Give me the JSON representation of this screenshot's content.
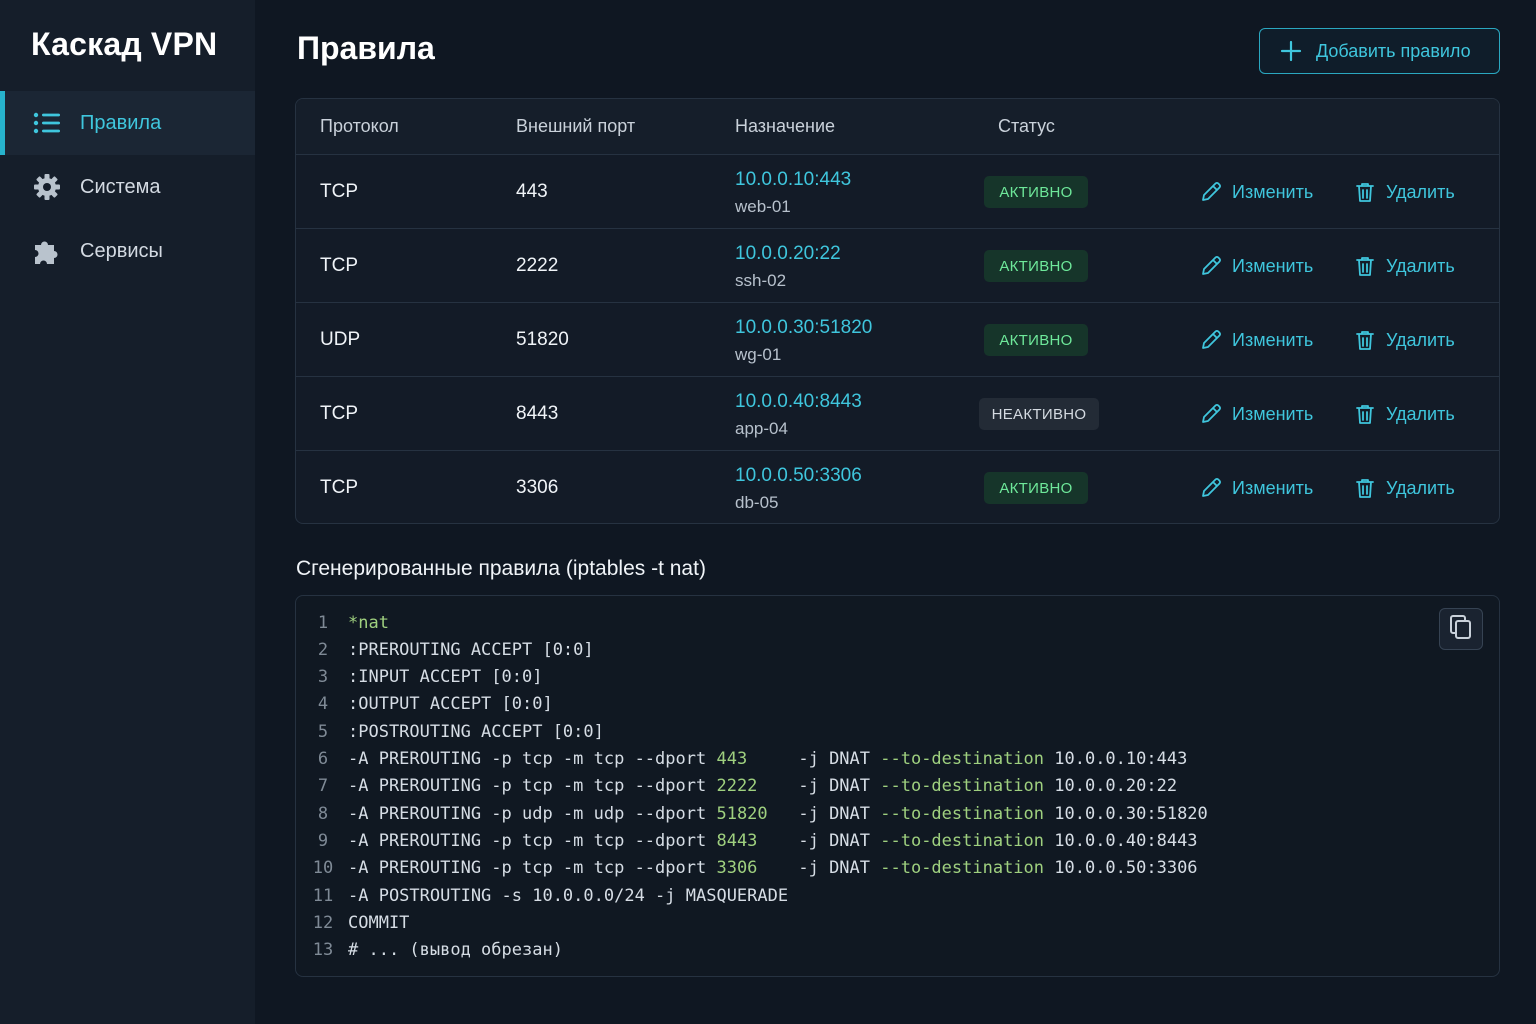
{
  "app": {
    "brand": "Каскад VPN"
  },
  "sidebar": {
    "items": [
      {
        "label": "Правила",
        "icon": "list-icon",
        "active": true
      },
      {
        "label": "Система",
        "icon": "gear-icon",
        "active": false
      },
      {
        "label": "Сервисы",
        "icon": "puzzle-icon",
        "active": false
      }
    ]
  },
  "header": {
    "title": "Правила",
    "add_label": "Добавить правило"
  },
  "table": {
    "columns": [
      "Протокол",
      "Внешний порт",
      "Назначение",
      "Статус"
    ],
    "edit_label": "Изменить",
    "delete_label": "Удалить",
    "rows": [
      {
        "protocol": "TCP",
        "port": "443",
        "dest_ip": "10.0.0.10:443",
        "dest_name": "web-01",
        "status": "АКТИВНО",
        "active": true
      },
      {
        "protocol": "TCP",
        "port": "2222",
        "dest_ip": "10.0.0.20:22",
        "dest_name": "ssh-02",
        "status": "АКТИВНО",
        "active": true
      },
      {
        "protocol": "UDP",
        "port": "51820",
        "dest_ip": "10.0.0.30:51820",
        "dest_name": "wg-01",
        "status": "АКТИВНО",
        "active": true
      },
      {
        "protocol": "TCP",
        "port": "8443",
        "dest_ip": "10.0.0.40:8443",
        "dest_name": "app-04",
        "status": "НЕАКТИВНО",
        "active": false
      },
      {
        "protocol": "TCP",
        "port": "3306",
        "dest_ip": "10.0.0.50:3306",
        "dest_name": "db-05",
        "status": "АКТИВНО",
        "active": true
      }
    ]
  },
  "generated": {
    "title": "Сгенерированные правила (iptables -t nat)",
    "lines": [
      {
        "n": "1",
        "parts": [
          {
            "t": "*nat",
            "g": true
          }
        ]
      },
      {
        "n": "2",
        "parts": [
          {
            "t": ":PREROUTING ACCEPT [0:0]"
          }
        ]
      },
      {
        "n": "3",
        "parts": [
          {
            "t": ":INPUT ACCEPT [0:0]"
          }
        ]
      },
      {
        "n": "4",
        "parts": [
          {
            "t": ":OUTPUT ACCEPT [0:0]"
          }
        ]
      },
      {
        "n": "5",
        "parts": [
          {
            "t": ":POSTROUTING ACCEPT [0:0]"
          }
        ]
      },
      {
        "n": "6",
        "parts": [
          {
            "t": "-A PREROUTING -p tcp -m tcp --dport "
          },
          {
            "t": "443  ",
            "g": true
          },
          {
            "t": "   -j DNAT "
          },
          {
            "t": "--to-destination",
            "g": true
          },
          {
            "t": " 10.0.0.10:443"
          }
        ]
      },
      {
        "n": "7",
        "parts": [
          {
            "t": "-A PREROUTING -p tcp -m tcp --dport "
          },
          {
            "t": "2222 ",
            "g": true
          },
          {
            "t": "   -j DNAT "
          },
          {
            "t": "--to-destination",
            "g": true
          },
          {
            "t": " 10.0.0.20:22"
          }
        ]
      },
      {
        "n": "8",
        "parts": [
          {
            "t": "-A PREROUTING -p udp -m udp --dport "
          },
          {
            "t": "51820",
            "g": true
          },
          {
            "t": "   -j DNAT "
          },
          {
            "t": "--to-destination",
            "g": true
          },
          {
            "t": " 10.0.0.30:51820"
          }
        ]
      },
      {
        "n": "9",
        "parts": [
          {
            "t": "-A PREROUTING -p tcp -m tcp --dport "
          },
          {
            "t": "8443 ",
            "g": true
          },
          {
            "t": "   -j DNAT "
          },
          {
            "t": "--to-destination",
            "g": true
          },
          {
            "t": " 10.0.0.40:8443"
          }
        ]
      },
      {
        "n": "10",
        "parts": [
          {
            "t": "-A PREROUTING -p tcp -m tcp --dport "
          },
          {
            "t": "3306 ",
            "g": true
          },
          {
            "t": "   -j DNAT "
          },
          {
            "t": "--to-destination",
            "g": true
          },
          {
            "t": " 10.0.0.50:3306"
          }
        ]
      },
      {
        "n": "11",
        "parts": [
          {
            "t": "-A POSTROUTING -s 10.0.0.0/24 -j MASQUERADE"
          }
        ]
      },
      {
        "n": "12",
        "parts": [
          {
            "t": "COMMIT"
          }
        ]
      },
      {
        "n": "13",
        "parts": [
          {
            "t": "# ... (вывод обрезан)"
          }
        ]
      }
    ]
  },
  "colors": {
    "accent": "#3fc6dd",
    "active_badge_bg": "#16352a",
    "active_badge_text": "#6ee89a",
    "code_green": "#9fd07f"
  }
}
